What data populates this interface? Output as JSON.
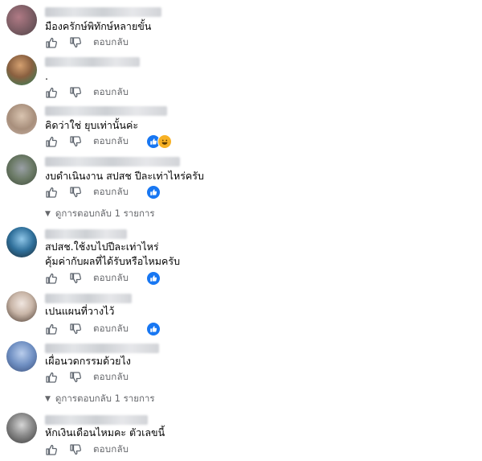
{
  "labels": {
    "reply": "ตอบกลับ"
  },
  "comments": [
    {
      "text": [
        "มืองครักษ์พิทักษ์หลายขั้น"
      ],
      "reactions": []
    },
    {
      "text": [
        "."
      ],
      "reactions": []
    },
    {
      "text": [
        "คิดว่าใช่ ยุบเท่านั้นค่ะ"
      ],
      "reactions": [
        "like",
        "haha"
      ]
    },
    {
      "text": [
        "งบดำเนินงาน สปสช ปีละเท่าไหร่ครับ"
      ],
      "reactions": [
        "like"
      ],
      "view_replies": "ดูการตอบกลับ 1 รายการ"
    },
    {
      "text": [
        "สปสช.ใช้งบไปปีละเท่าไหร่",
        "คุ้มค่ากับผลที่ได้รับหรือไหมครับ"
      ],
      "reactions": [
        "like"
      ]
    },
    {
      "text": [
        "เปนแผนที่วางไว้"
      ],
      "reactions": [
        "like"
      ]
    },
    {
      "text": [
        "เผื่อนวดกรรมด้วยไง"
      ],
      "reactions": [],
      "view_replies": "ดูการตอบกลับ 1 รายการ"
    },
    {
      "text": [
        "หักเงินเดือนไหมคะ ตัวเลขนี้"
      ],
      "reactions": []
    }
  ],
  "colors": {
    "reply_gray": "#65676b",
    "like_blue": "#1877f2",
    "haha_yellow": "#f7b125",
    "text_dark": "#050505"
  },
  "icons": {
    "like": "thumbs-up-outline",
    "dislike": "thumbs-down-outline",
    "reaction_like": "blue-thumbs-up-badge",
    "reaction_haha": "laughing-face-badge",
    "expand": "chevron-down"
  }
}
